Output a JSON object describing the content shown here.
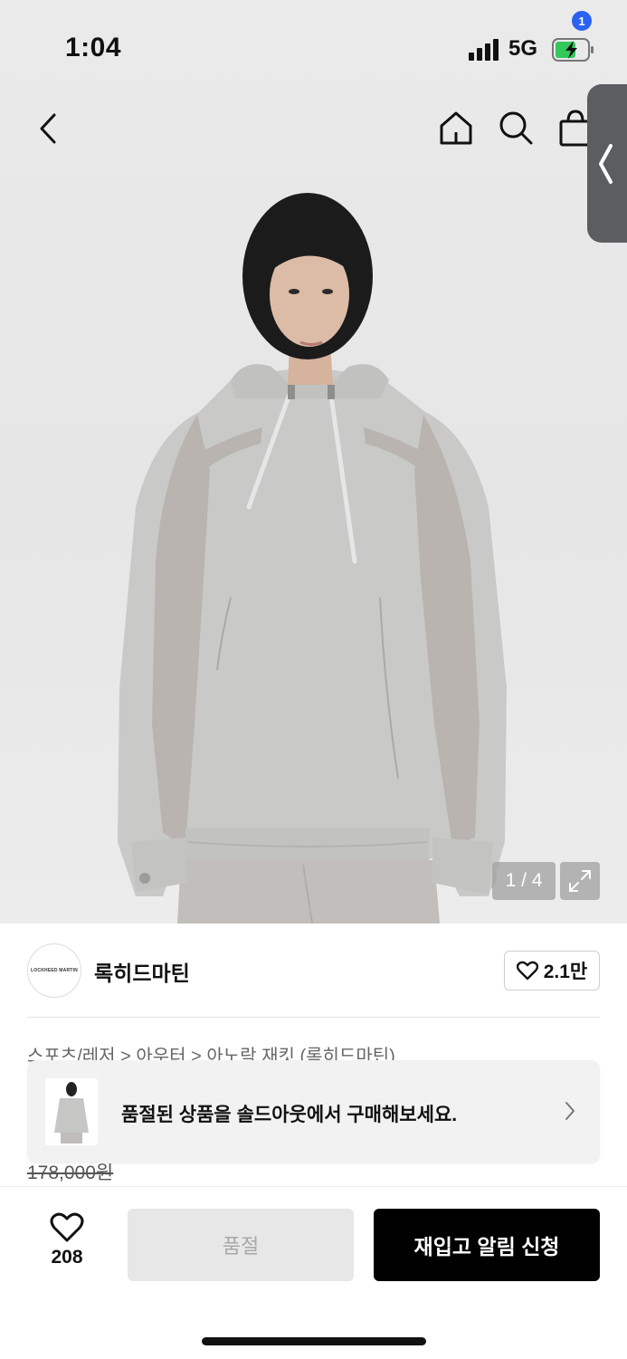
{
  "status_bar": {
    "time": "1:04",
    "network": "5G"
  },
  "header": {
    "cart_count": "1"
  },
  "gallery": {
    "page_indicator": "1 / 4"
  },
  "brand": {
    "name": "록히드마틴",
    "logo_text": "LOCKHEED MARTIN",
    "likes": "2.1만"
  },
  "breadcrumb": "스포츠/레저  >  아우터  >  아노락 재킷 (록히드마틴)",
  "banner": {
    "text": "품절된 상품을 솔드아웃에서 구매해보세요."
  },
  "price": {
    "original": "178,000원"
  },
  "bottom_bar": {
    "wish_count": "208",
    "soldout_label": "품절",
    "restock_label": "재입고 알림 신청"
  },
  "colors": {
    "accent_blue": "#2a63f2",
    "jacket_grey": "#c6c7c5",
    "panel_grey": "#b7b2ad",
    "black": "#000000"
  },
  "icons": [
    "back-icon",
    "home-icon",
    "search-icon",
    "cart-icon",
    "side-chevron-icon",
    "expand-icon",
    "heart-icon",
    "chevron-right-icon",
    "signal-icon",
    "battery-icon"
  ]
}
